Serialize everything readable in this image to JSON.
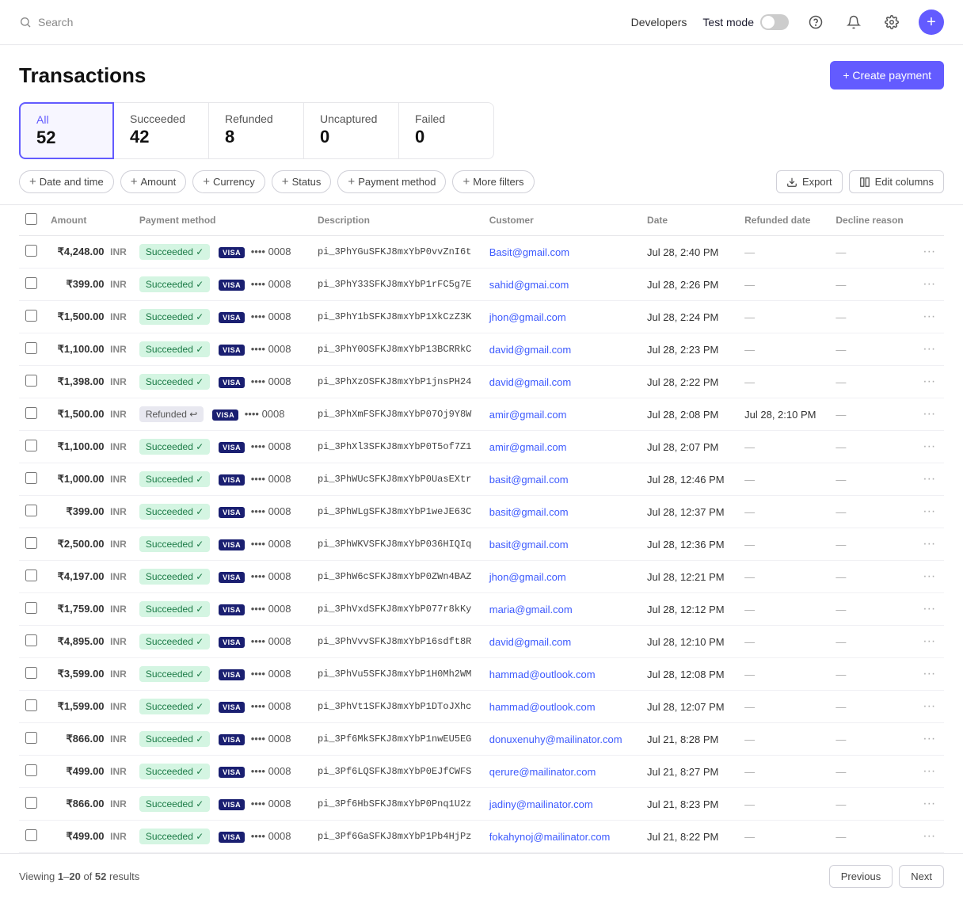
{
  "nav": {
    "search_placeholder": "Search",
    "developers": "Developers",
    "test_mode": "Test mode",
    "plus_label": "+"
  },
  "page": {
    "title": "Transactions",
    "create_btn": "+ Create payment"
  },
  "filter_tabs": [
    {
      "name": "All",
      "count": "52",
      "active": true
    },
    {
      "name": "Succeeded",
      "count": "42",
      "active": false
    },
    {
      "name": "Refunded",
      "count": "8",
      "active": false
    },
    {
      "name": "Uncaptured",
      "count": "0",
      "active": false
    },
    {
      "name": "Failed",
      "count": "0",
      "active": false
    }
  ],
  "filter_chips": [
    "Date and time",
    "Amount",
    "Currency",
    "Status",
    "Payment method",
    "More filters"
  ],
  "action_buttons": [
    "Export",
    "Edit columns"
  ],
  "table": {
    "columns": [
      "",
      "Amount",
      "Payment method",
      "Description",
      "Customer",
      "Date",
      "Refunded date",
      "Decline reason",
      ""
    ],
    "rows": [
      {
        "amount": "₹4,248.00",
        "currency": "INR",
        "status": "Succeeded",
        "card": "0008",
        "desc": "pi_3PhYGuSFKJ8mxYbP0vvZnI6t",
        "customer": "Basit@gmail.com",
        "date": "Jul 28, 2:40 PM",
        "refunded": "—",
        "decline": "—"
      },
      {
        "amount": "₹399.00",
        "currency": "INR",
        "status": "Succeeded",
        "card": "0008",
        "desc": "pi_3PhY33SFKJ8mxYbP1rFC5g7E",
        "customer": "sahid@gmai.com",
        "date": "Jul 28, 2:26 PM",
        "refunded": "—",
        "decline": "—"
      },
      {
        "amount": "₹1,500.00",
        "currency": "INR",
        "status": "Succeeded",
        "card": "0008",
        "desc": "pi_3PhY1bSFKJ8mxYbP1XkCzZ3K",
        "customer": "jhon@gmail.com",
        "date": "Jul 28, 2:24 PM",
        "refunded": "—",
        "decline": "—"
      },
      {
        "amount": "₹1,100.00",
        "currency": "INR",
        "status": "Succeeded",
        "card": "0008",
        "desc": "pi_3PhY0OSFKJ8mxYbP13BCRRkC",
        "customer": "david@gmail.com",
        "date": "Jul 28, 2:23 PM",
        "refunded": "—",
        "decline": "—"
      },
      {
        "amount": "₹1,398.00",
        "currency": "INR",
        "status": "Succeeded",
        "card": "0008",
        "desc": "pi_3PhXzOSFKJ8mxYbP1jnsPH24",
        "customer": "david@gmail.com",
        "date": "Jul 28, 2:22 PM",
        "refunded": "—",
        "decline": "—"
      },
      {
        "amount": "₹1,500.00",
        "currency": "INR",
        "status": "Refunded",
        "card": "0008",
        "desc": "pi_3PhXmFSFKJ8mxYbP07Oj9Y8W",
        "customer": "amir@gmail.com",
        "date": "Jul 28, 2:08 PM",
        "refunded": "Jul 28, 2:10 PM",
        "decline": "—"
      },
      {
        "amount": "₹1,100.00",
        "currency": "INR",
        "status": "Succeeded",
        "card": "0008",
        "desc": "pi_3PhXl3SFKJ8mxYbP0T5of7Z1",
        "customer": "amir@gmail.com",
        "date": "Jul 28, 2:07 PM",
        "refunded": "—",
        "decline": "—"
      },
      {
        "amount": "₹1,000.00",
        "currency": "INR",
        "status": "Succeeded",
        "card": "0008",
        "desc": "pi_3PhWUcSFKJ8mxYbP0UasEXtr",
        "customer": "basit@gmail.com",
        "date": "Jul 28, 12:46 PM",
        "refunded": "—",
        "decline": "—"
      },
      {
        "amount": "₹399.00",
        "currency": "INR",
        "status": "Succeeded",
        "card": "0008",
        "desc": "pi_3PhWLgSFKJ8mxYbP1weJE63C",
        "customer": "basit@gmail.com",
        "date": "Jul 28, 12:37 PM",
        "refunded": "—",
        "decline": "—"
      },
      {
        "amount": "₹2,500.00",
        "currency": "INR",
        "status": "Succeeded",
        "card": "0008",
        "desc": "pi_3PhWKVSFKJ8mxYbP036HIQIq",
        "customer": "basit@gmail.com",
        "date": "Jul 28, 12:36 PM",
        "refunded": "—",
        "decline": "—"
      },
      {
        "amount": "₹4,197.00",
        "currency": "INR",
        "status": "Succeeded",
        "card": "0008",
        "desc": "pi_3PhW6cSFKJ8mxYbP0ZWn4BAZ",
        "customer": "jhon@gmail.com",
        "date": "Jul 28, 12:21 PM",
        "refunded": "—",
        "decline": "—"
      },
      {
        "amount": "₹1,759.00",
        "currency": "INR",
        "status": "Succeeded",
        "card": "0008",
        "desc": "pi_3PhVxdSFKJ8mxYbP077r8kKy",
        "customer": "maria@gmail.com",
        "date": "Jul 28, 12:12 PM",
        "refunded": "—",
        "decline": "—"
      },
      {
        "amount": "₹4,895.00",
        "currency": "INR",
        "status": "Succeeded",
        "card": "0008",
        "desc": "pi_3PhVvvSFKJ8mxYbP16sdft8R",
        "customer": "david@gmail.com",
        "date": "Jul 28, 12:10 PM",
        "refunded": "—",
        "decline": "—"
      },
      {
        "amount": "₹3,599.00",
        "currency": "INR",
        "status": "Succeeded",
        "card": "0008",
        "desc": "pi_3PhVu5SFKJ8mxYbP1H0Mh2WM",
        "customer": "hammad@outlook.com",
        "date": "Jul 28, 12:08 PM",
        "refunded": "—",
        "decline": "—"
      },
      {
        "amount": "₹1,599.00",
        "currency": "INR",
        "status": "Succeeded",
        "card": "0008",
        "desc": "pi_3PhVt1SFKJ8mxYbP1DToJXhc",
        "customer": "hammad@outlook.com",
        "date": "Jul 28, 12:07 PM",
        "refunded": "—",
        "decline": "—"
      },
      {
        "amount": "₹866.00",
        "currency": "INR",
        "status": "Succeeded",
        "card": "0008",
        "desc": "pi_3Pf6MkSFKJ8mxYbP1nwEU5EG",
        "customer": "donuxenuhy@mailinator.com",
        "date": "Jul 21, 8:28 PM",
        "refunded": "—",
        "decline": "—"
      },
      {
        "amount": "₹499.00",
        "currency": "INR",
        "status": "Succeeded",
        "card": "0008",
        "desc": "pi_3Pf6LQSFKJ8mxYbP0EJfCWFS",
        "customer": "qerure@mailinator.com",
        "date": "Jul 21, 8:27 PM",
        "refunded": "—",
        "decline": "—"
      },
      {
        "amount": "₹866.00",
        "currency": "INR",
        "status": "Succeeded",
        "card": "0008",
        "desc": "pi_3Pf6HbSFKJ8mxYbP0Pnq1U2z",
        "customer": "jadiny@mailinator.com",
        "date": "Jul 21, 8:23 PM",
        "refunded": "—",
        "decline": "—"
      },
      {
        "amount": "₹499.00",
        "currency": "INR",
        "status": "Succeeded",
        "card": "0008",
        "desc": "pi_3Pf6GaSFKJ8mxYbP1Pb4HjPz",
        "customer": "fokahynoj@mailinator.com",
        "date": "Jul 21, 8:22 PM",
        "refunded": "—",
        "decline": "—"
      }
    ]
  },
  "footer": {
    "viewing_text": "Viewing",
    "range_start": "1",
    "range_end": "20",
    "of": "of",
    "total": "52",
    "results": "results",
    "prev_btn": "Previous",
    "next_btn": "Next"
  }
}
